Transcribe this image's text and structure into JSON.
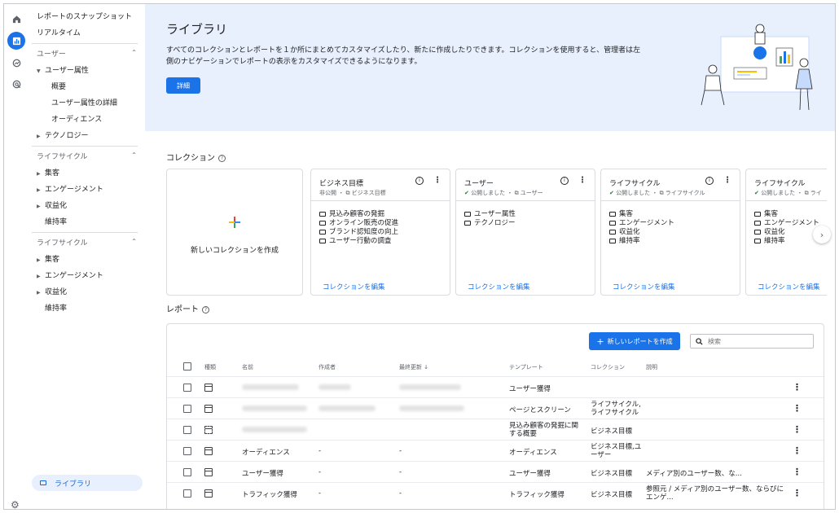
{
  "nav": {
    "top_items": [
      "レポートのスナップショット",
      "リアルタイム"
    ],
    "group_user": {
      "label": "ユーザー",
      "items": [
        {
          "label": "ユーザー属性",
          "expanded": true
        },
        {
          "label": "概要"
        },
        {
          "label": "ユーザー属性の詳細"
        },
        {
          "label": "オーディエンス"
        },
        {
          "label": "テクノロジー"
        }
      ]
    },
    "group_lifecycle_1": {
      "label": "ライフサイクル",
      "items": [
        "集客",
        "エンゲージメント",
        "収益化",
        "維持率"
      ]
    },
    "group_lifecycle_2": {
      "label": "ライフサイクル",
      "items": [
        "集客",
        "エンゲージメント",
        "収益化",
        "維持率"
      ]
    },
    "library_label": "ライブラリ"
  },
  "banner": {
    "title": "ライブラリ",
    "description_1": "すべてのコレクションとレポートを１か所にまとめてカスタマイズしたり、新たに作成したりできます。コレクションを使用すると、管理者は左",
    "description_2": "側のナビゲーションでレポートの表示をカスタマイズできるようになります。",
    "detail_button": "詳細"
  },
  "collections": {
    "title": "コレクション",
    "new_label": "新しいコレクションを作成",
    "edit_label": "コレクションを編集",
    "cards": [
      {
        "title": "ビジネス目標",
        "status": "非公開",
        "template": "ビジネス目標",
        "items": [
          "見込み顧客の発掘",
          "オンライン販売の促進",
          "ブランド認知度の向上",
          "ユーザー行動の調査"
        ]
      },
      {
        "title": "ユーザー",
        "status": "公開しました",
        "template": "ユーザー",
        "items": [
          "ユーザー属性",
          "テクノロジー"
        ]
      },
      {
        "title": "ライフサイクル",
        "status": "公開しました",
        "template": "ライフサイクル",
        "items": [
          "集客",
          "エンゲージメント",
          "収益化",
          "維持率"
        ]
      },
      {
        "title": "ライフサイクル",
        "status": "公開しました",
        "template": "ライ",
        "items": [
          "集客",
          "エンゲージメント",
          "収益化",
          "維持率"
        ]
      }
    ]
  },
  "reports": {
    "title": "レポート",
    "new_button": "新しいレポートを作成",
    "search_placeholder": "検索",
    "columns": {
      "type": "種類",
      "name": "名前",
      "creator": "作成者",
      "updated": "最終更新",
      "template": "テンプレート",
      "collection": "コレクション",
      "description": "説明"
    },
    "rows": [
      {
        "name": "",
        "creator": "",
        "updated": "",
        "template": "ユーザー獲得",
        "collection": "",
        "description": ""
      },
      {
        "name": "",
        "creator": "",
        "updated": "",
        "template": "ページとスクリーン",
        "collection_1": "ライフサイクル,",
        "collection_2": "ライフサイクル",
        "description": ""
      },
      {
        "name": "",
        "creator": "",
        "updated": "",
        "template_1": "見込み顧客の発掘に関",
        "template_2": "する概要",
        "collection": "ビジネス目標",
        "description": ""
      },
      {
        "name": "オーディエンス",
        "creator": "-",
        "updated": "-",
        "template": "オーディエンス",
        "collection_1": "ビジネス目標,ユ",
        "collection_2": "ーザー",
        "description": ""
      },
      {
        "name": "ユーザー獲得",
        "creator": "-",
        "updated": "-",
        "template": "ユーザー獲得",
        "collection": "ビジネス目標",
        "description": "メディア別のユーザー数、な..."
      },
      {
        "name": "トラフィック獲得",
        "creator": "-",
        "updated": "-",
        "template": "トラフィック獲得",
        "collection": "ビジネス目標",
        "description_1": "参照元 / メディア別のユーザー数、ならびに",
        "description_2": "エンゲ..."
      }
    ]
  },
  "colors": {
    "accent": "#1a73e8",
    "banner_bg": "#e8f0fe",
    "border": "#dadce0"
  }
}
